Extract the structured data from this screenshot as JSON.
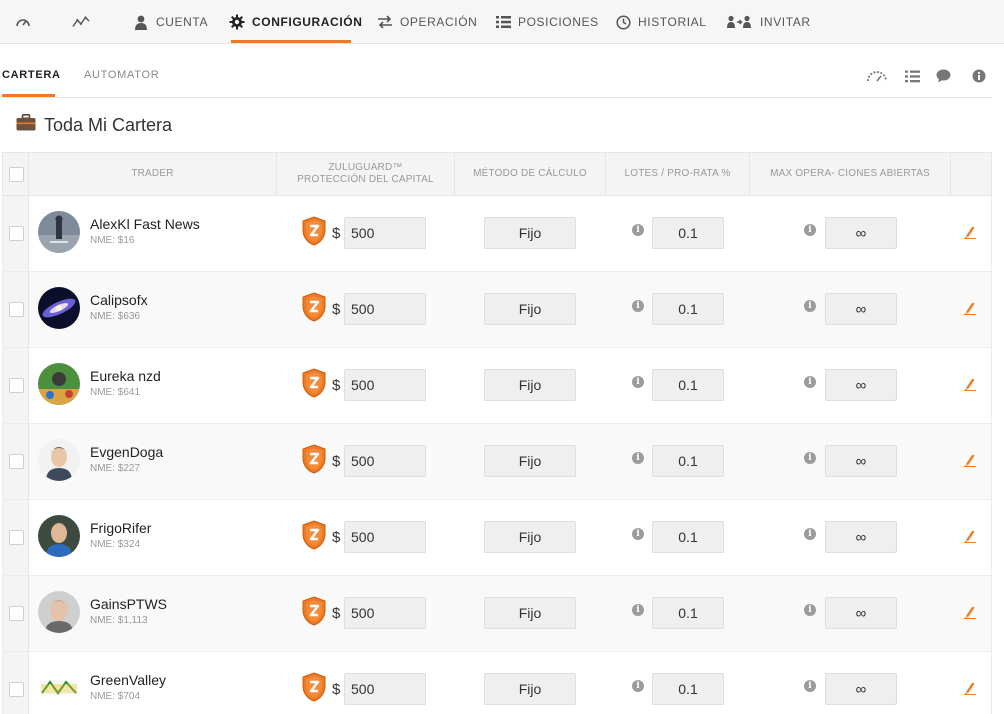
{
  "nav": {
    "items": [
      {
        "label": "",
        "icon": "dashboard-gauge-icon"
      },
      {
        "label": "",
        "icon": "performance-chart-icon"
      },
      {
        "label": "Cuenta",
        "icon": "user-icon"
      },
      {
        "label": "Configuración",
        "icon": "gear-icon",
        "active": true
      },
      {
        "label": "Operación",
        "icon": "transfer-arrows-icon"
      },
      {
        "label": "Posiciones",
        "icon": "list-icon"
      },
      {
        "label": "Historial",
        "icon": "clock-icon"
      },
      {
        "label": "Invitar",
        "icon": "invite-users-icon"
      }
    ]
  },
  "subtabs": [
    {
      "label": "Cartera",
      "active": true
    },
    {
      "label": "Automator",
      "active": false
    }
  ],
  "page": {
    "title": "Toda Mi Cartera",
    "title_icon": "briefcase-icon"
  },
  "table": {
    "headers": {
      "trader": "Trader",
      "zuluguard_line1": "ZuluGuard™",
      "zuluguard_line2": "Protección del Capital",
      "method": "Método de Cálculo",
      "lots": "Lotes / Pro-Rata %",
      "max": "Max Opera- ciones Abiertas"
    },
    "currency": "$",
    "rows": [
      {
        "name": "AlexKl Fast News",
        "nme": "NME: $16",
        "guard": "500",
        "method": "Fijo",
        "lots": "0.1",
        "max": "∞"
      },
      {
        "name": "Calipsofx",
        "nme": "NME: $636",
        "guard": "500",
        "method": "Fijo",
        "lots": "0.1",
        "max": "∞"
      },
      {
        "name": "Eureka nzd",
        "nme": "NME: $641",
        "guard": "500",
        "method": "Fijo",
        "lots": "0.1",
        "max": "∞"
      },
      {
        "name": "EvgenDoga",
        "nme": "NME: $227",
        "guard": "500",
        "method": "Fijo",
        "lots": "0.1",
        "max": "∞"
      },
      {
        "name": "FrigoRifer",
        "nme": "NME: $324",
        "guard": "500",
        "method": "Fijo",
        "lots": "0.1",
        "max": "∞"
      },
      {
        "name": "GainsPTWS",
        "nme": "NME: $1,113",
        "guard": "500",
        "method": "Fijo",
        "lots": "0.1",
        "max": "∞"
      },
      {
        "name": "GreenValley",
        "nme": "NME: $704",
        "guard": "500",
        "method": "Fijo",
        "lots": "0.1",
        "max": "∞"
      }
    ]
  },
  "colors": {
    "accent": "#f07a21",
    "shield": "#f07a21"
  }
}
